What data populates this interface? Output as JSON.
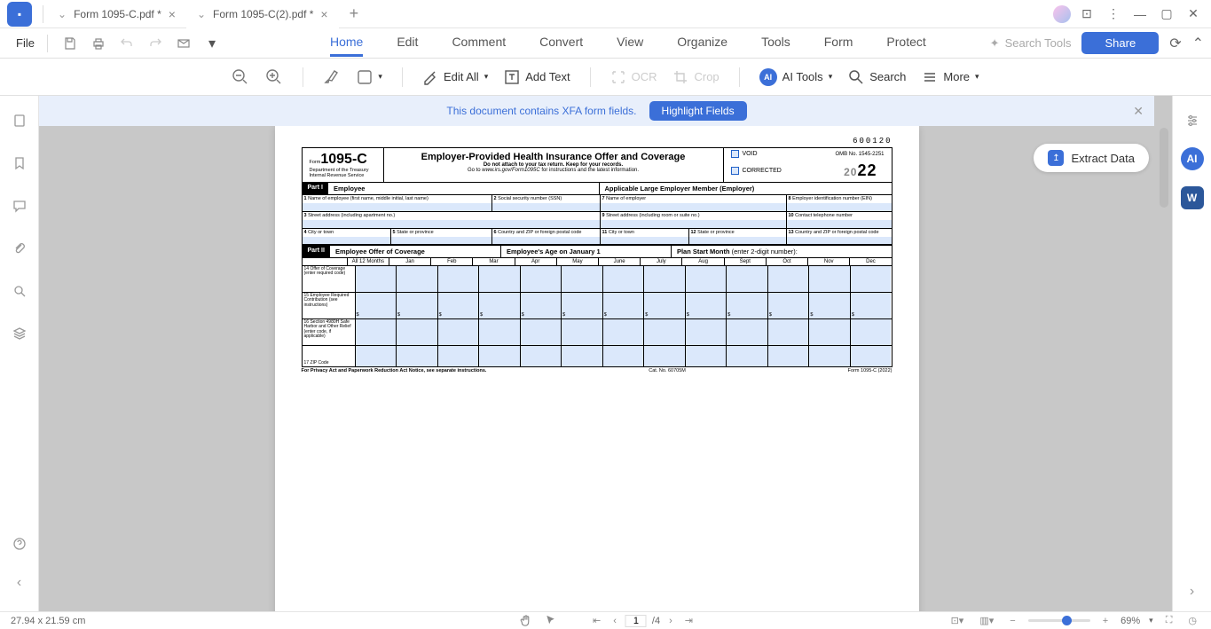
{
  "titlebar": {
    "tabs": [
      {
        "label": "Form 1095-C.pdf *"
      },
      {
        "label": "Form 1095-C(2).pdf *"
      }
    ]
  },
  "menubar": {
    "file": "File",
    "tabs": [
      "Home",
      "Edit",
      "Comment",
      "Convert",
      "View",
      "Organize",
      "Tools",
      "Form",
      "Protect"
    ],
    "searchPlaceholder": "Search Tools",
    "share": "Share"
  },
  "toolbar": {
    "editAll": "Edit All",
    "addText": "Add Text",
    "ocr": "OCR",
    "crop": "Crop",
    "aiTools": "AI Tools",
    "search": "Search",
    "more": "More"
  },
  "banner": {
    "text": "This document contains XFA form fields.",
    "button": "Highlight Fields"
  },
  "extractPill": "Extract Data",
  "form": {
    "barcode": "600120",
    "formNum": "1095-C",
    "formPrefix": "Form",
    "dept1": "Department of the Treasury",
    "dept2": "Internal Revenue Service",
    "title": "Employer-Provided Health Insurance Offer and Coverage",
    "sub1": "Do not attach to your tax return. Keep for your records.",
    "sub2a": "Go to ",
    "sub2b": "www.irs.gov/Form1095C",
    "sub2c": " for instructions and the latest information.",
    "voidLabel": "VOID",
    "correctedLabel": "CORRECTED",
    "ombNo": "OMB No. 1545-2251",
    "year": "2022",
    "yearPrefix": "20",
    "part1": "Part I",
    "employeeLabel": "Employee",
    "employerLabel": "Applicable Large Employer Member (Employer)",
    "f1": "Name of employee (first name, middle initial, last name)",
    "f2": "Social security number (SSN)",
    "f7": "Name of employer",
    "f8": "Employer identification number (EIN)",
    "f3": "Street address (including apartment no.)",
    "f9": "Street address (including room or suite no.)",
    "f10": "Contact telephone number",
    "f4": "City or town",
    "f5": "State or province",
    "f6": "Country and ZIP or foreign postal code",
    "f11": "City or town",
    "f12": "State or province",
    "f13": "Country and ZIP or foreign postal code",
    "part2": "Part II",
    "part2Label": "Employee Offer of Coverage",
    "ageLabel": "Employee's Age on January 1",
    "planStart": "Plan Start Month",
    "planStartHint": " (enter 2-digit number):",
    "months": [
      "All 12 Months",
      "Jan",
      "Feb",
      "Mar",
      "Apr",
      "May",
      "June",
      "July",
      "Aug",
      "Sept",
      "Oct",
      "Nov",
      "Dec"
    ],
    "row14": "14 Offer of Coverage (enter required code)",
    "row15": "15 Employee Required Contribution (see instructions)",
    "row16": "16 Section 4980H Safe Harbor and Other Relief (enter code, if applicable)",
    "row17": "17 ZIP Code",
    "privacy": "For Privacy Act and Paperwork Reduction Act Notice, see separate instructions.",
    "catNo": "Cat. No. 60705M",
    "formFooter": "Form 1095-C (2022)",
    "dollarSign": "$"
  },
  "statusbar": {
    "dims": "27.94 x 21.59 cm",
    "pageCurrent": "1",
    "pageTotal": "/4",
    "zoom": "69%"
  }
}
